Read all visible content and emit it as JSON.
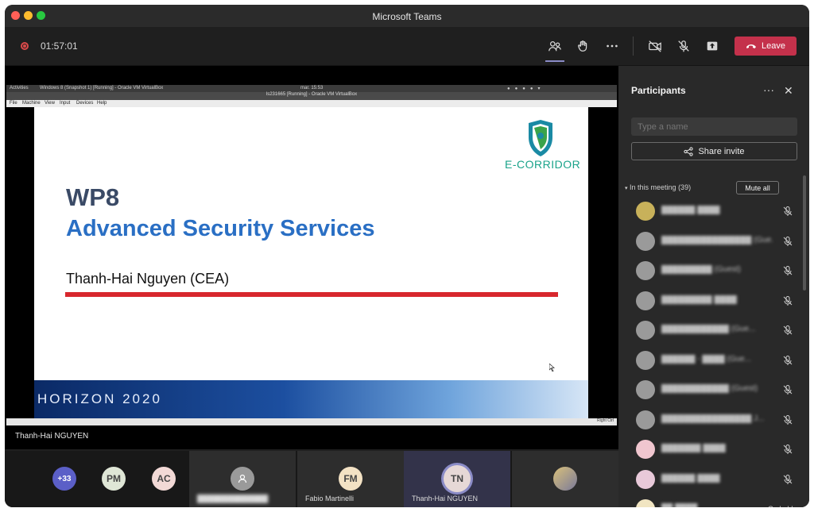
{
  "app": {
    "title": "Microsoft Teams"
  },
  "toolbar": {
    "timer": "01:57:01",
    "leave_label": "Leave",
    "icons": [
      "people-icon",
      "raise-hand-icon",
      "more-icon",
      "camera-off-icon",
      "mic-off-icon",
      "share-tray-icon"
    ]
  },
  "stage": {
    "vm_activities": "Activities",
    "vm_window": "Windows 8 (Snapshot 1) [Running] - Oracle VM VirtualBox",
    "vm_clock": "mar. 15:53",
    "vm_title": "ls231665 [Running] - Oracle VM VirtualBox",
    "vm_menu": [
      "File",
      "Machine",
      "View",
      "Input",
      "Devices",
      "Help"
    ],
    "vm_status": "Right Ctrl",
    "slide": {
      "logo_text": "E-CORRIDOR",
      "wp": "WP8",
      "subtitle": "Advanced Security Services",
      "author": "Thanh-Hai Nguyen (CEA)",
      "footer_text": "HORIZON 2020"
    },
    "presenter_name": "Thanh-Hai NGUYEN"
  },
  "bottom": {
    "overflow_count": "+33",
    "small_avatars": [
      {
        "initials": "PM",
        "bg": "#dfe6d6",
        "fg": "#444"
      },
      {
        "initials": "AC",
        "bg": "#f2d9d6",
        "fg": "#444"
      }
    ],
    "tiles": [
      {
        "name": "",
        "initials": "",
        "bg": "#2d2d2d"
      },
      {
        "name": "Fabio Martinelli",
        "initials": "FM",
        "bg": "#2d2d2d"
      },
      {
        "name": "Thanh-Hai NGUYEN",
        "initials": "TN",
        "bg": "#3a3a58"
      },
      {
        "name": "",
        "initials": "",
        "bg": "#2d2d2d"
      }
    ]
  },
  "participants": {
    "title": "Participants",
    "search_placeholder": "Type a name",
    "share_label": "Share invite",
    "section_label": "In this meeting (39)",
    "mute_all_label": "Mute all",
    "rows": [
      {
        "name": "██████ ████",
        "status": ""
      },
      {
        "name": "████████████████ (Gue...",
        "status": ""
      },
      {
        "name": "█████████ (Guest)",
        "status": ""
      },
      {
        "name": "█████████ ████",
        "status": ""
      },
      {
        "name": "████████████ (Gue...",
        "status": ""
      },
      {
        "name": "██████ - ████ (Gue...",
        "status": ""
      },
      {
        "name": "████████████ (Guest)",
        "status": ""
      },
      {
        "name": "████████████████ J...",
        "status": ""
      },
      {
        "name": "███████ ████",
        "status": ""
      },
      {
        "name": "██████ ████",
        "status": ""
      },
      {
        "name": "██ ████",
        "status": "On hold"
      }
    ]
  }
}
